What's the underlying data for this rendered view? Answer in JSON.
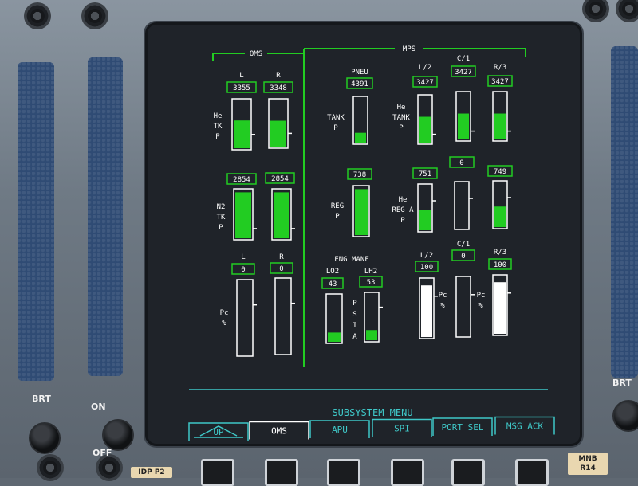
{
  "colors": {
    "screen_bg": "#1f2329",
    "green": "#22cc22",
    "white": "#ffffff",
    "teal": "#3fc8c8",
    "panel_blue": "#2f4b74",
    "placard": "#e9d7b0"
  },
  "oms": {
    "title": "OMS",
    "he_tk_p": {
      "label_lines": [
        "He",
        "TK",
        "P"
      ],
      "l_label": "L",
      "r_label": "R",
      "l_value": "3355",
      "r_value": "3348",
      "l_fill": 0.58,
      "r_fill": 0.56
    },
    "n2_tk_p": {
      "label_lines": [
        "N2",
        "TK",
        "P"
      ],
      "l_value": "2854",
      "r_value": "2854",
      "l_fill": 0.96,
      "r_fill": 0.96
    },
    "pc": {
      "label_lines": [
        "Pc",
        "%"
      ],
      "l_label": "L",
      "r_label": "R",
      "l_value": "0",
      "r_value": "0",
      "l_fill": 0.0,
      "r_fill": 0.0
    }
  },
  "mps": {
    "title": "MPS",
    "pneu": {
      "title": "PNEU",
      "tank_label_lines": [
        "TANK",
        "P"
      ],
      "tank_value": "4391",
      "tank_fill": 0.22,
      "reg_label_lines": [
        "REG",
        "P"
      ],
      "reg_value": "738",
      "reg_fill": 0.96
    },
    "he_tank_p": {
      "label_lines": [
        "He",
        "TANK",
        "P"
      ],
      "engines": [
        {
          "label": "L/2",
          "value": "3427",
          "fill": 0.56
        },
        {
          "label": "C/1",
          "value": "3427",
          "fill": 0.56
        },
        {
          "label": "R/3",
          "value": "3427",
          "fill": 0.56
        }
      ]
    },
    "he_reg_a_p": {
      "label_lines": [
        "He",
        "REG A",
        "P"
      ],
      "engines": [
        {
          "value": "751",
          "fill": 0.46
        },
        {
          "value": "0",
          "fill": 0.0
        },
        {
          "value": "749",
          "fill": 0.46
        }
      ]
    },
    "eng_manf": {
      "title": "ENG MANF",
      "lo2_label": "LO2",
      "lh2_label": "LH2",
      "lo2_value": "43",
      "lh2_value": "53",
      "lo2_fill": 0.2,
      "lh2_fill": 0.22,
      "psia_letters": [
        "P",
        "S",
        "I",
        "A"
      ]
    },
    "pc": {
      "label_lines": [
        "Pc",
        "%"
      ],
      "engines": [
        {
          "label": "L/2",
          "value": "100",
          "fill": 0.9
        },
        {
          "label": "C/1",
          "value": "0",
          "fill": 0.0
        },
        {
          "label": "R/3",
          "value": "100",
          "fill": 0.9
        }
      ]
    }
  },
  "menu": {
    "title": "SUBSYSTEM MENU",
    "buttons": [
      {
        "label": "UP",
        "selected": false
      },
      {
        "label": "OMS",
        "selected": true
      },
      {
        "label": "APU",
        "selected": false
      },
      {
        "label": "SPI",
        "selected": false
      },
      {
        "label": "PORT SEL",
        "selected": false
      },
      {
        "label": "MSG ACK",
        "selected": false
      }
    ]
  },
  "panel": {
    "brt_left": "BRT",
    "brt_right": "BRT",
    "on_label": "ON",
    "off_label": "OFF",
    "placard_left": "IDP P2",
    "placard_right_1": "MNB",
    "placard_right_2": "R14"
  }
}
